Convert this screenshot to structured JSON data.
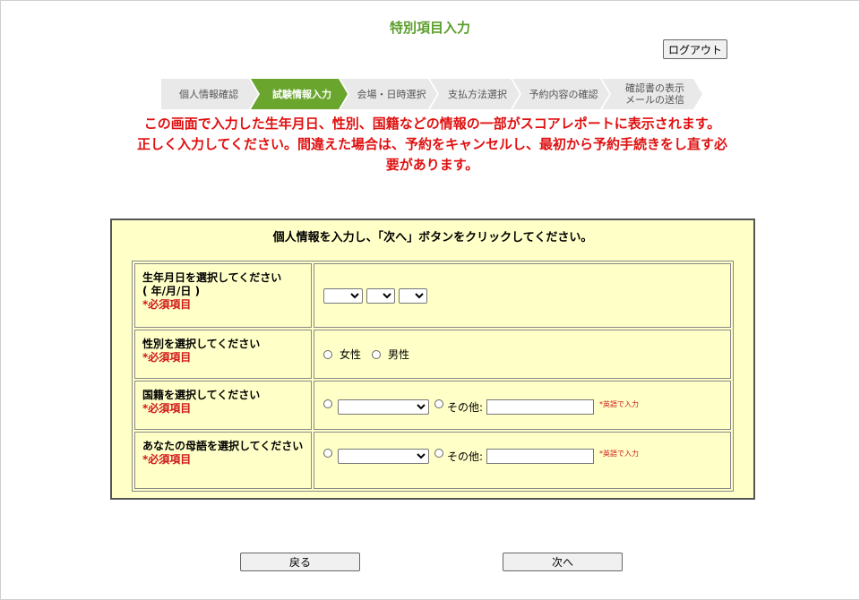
{
  "header": {
    "title": "特別項目入力",
    "logout_label": "ログアウト"
  },
  "steps": [
    {
      "label": "個人情報確認",
      "active": false
    },
    {
      "label": "試験情報入力",
      "active": true
    },
    {
      "label": "会場・日時選択",
      "active": false
    },
    {
      "label": "支払方法選択",
      "active": false
    },
    {
      "label": "予約内容の確認",
      "active": false
    },
    {
      "label": "確認書の表示\nメールの送信",
      "active": false
    }
  ],
  "warning": {
    "line1": "この画面で入力した生年月日、性別、国籍などの情報の一部がスコアレポートに表示されます。",
    "line2": "正しく入力してください。間違えた場合は、予約をキャンセルし、最初から予約手続きをし直す必要があります。"
  },
  "form": {
    "instruction": "個人情報を入力し、「次へ」ボタンをクリックしてください。",
    "required_mark": "*必須項目",
    "birthdate": {
      "label": "生年月日を選択してください",
      "format": "( 年/月/日 )",
      "year": "",
      "month": "",
      "day": ""
    },
    "gender": {
      "label": "性別を選択してください",
      "options": [
        "女性",
        "男性"
      ]
    },
    "nationality": {
      "label": "国籍を選択してください",
      "selected": "",
      "other_label": "その他:",
      "other_value": "",
      "hint": "*英語で入力"
    },
    "native_language": {
      "label": "あなたの母語を選択してください",
      "selected": "",
      "other_label": "その他:",
      "other_value": "",
      "hint": "*英語で入力"
    }
  },
  "footer": {
    "back_label": "戻る",
    "next_label": "次へ"
  },
  "colors": {
    "accent_green": "#6aa62e",
    "title_green": "#5a9e2a",
    "warning_red": "#e01010",
    "form_bg": "#ffffc8"
  }
}
